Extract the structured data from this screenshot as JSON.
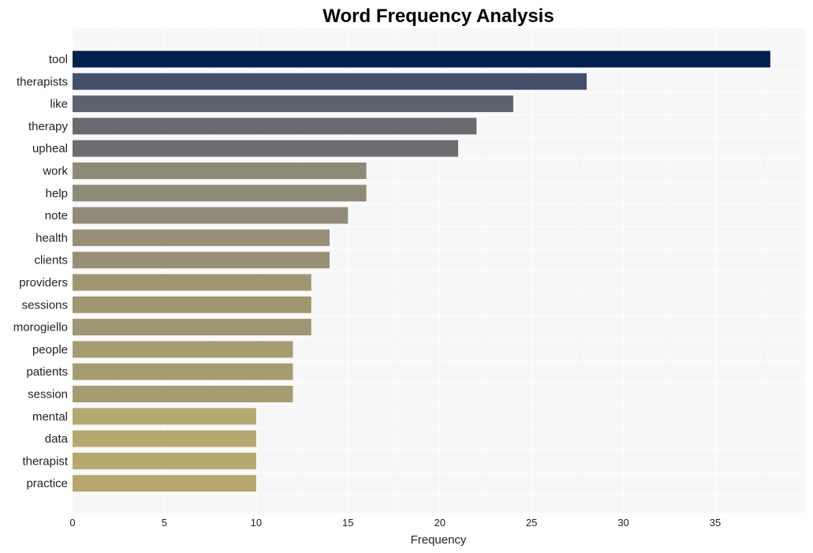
{
  "chart_data": {
    "type": "bar",
    "orientation": "horizontal",
    "title": "Word Frequency Analysis",
    "xlabel": "Frequency",
    "ylabel": "",
    "xlim": [
      0,
      40
    ],
    "xticks": [
      0,
      5,
      10,
      15,
      20,
      25,
      30,
      35
    ],
    "grid": true,
    "legend": "none",
    "categories": [
      "tool",
      "therapists",
      "like",
      "therapy",
      "upheal",
      "work",
      "help",
      "note",
      "health",
      "clients",
      "providers",
      "sessions",
      "morogiello",
      "people",
      "patients",
      "session",
      "mental",
      "data",
      "therapist",
      "practice"
    ],
    "values": [
      38,
      28,
      24,
      22,
      21,
      16,
      16,
      15,
      14,
      14,
      13,
      13,
      13,
      12,
      12,
      12,
      10,
      10,
      10,
      10
    ],
    "colors": [
      "#00204e",
      "#45516b",
      "#5c616f",
      "#696a70",
      "#6c6d71",
      "#8d8a78",
      "#8d8a78",
      "#8f8b77",
      "#979076",
      "#979076",
      "#9f9672",
      "#9f9672",
      "#9f9672",
      "#a59c72",
      "#a59c72",
      "#a59c72",
      "#b6a970",
      "#b6a970",
      "#b6a970",
      "#b6a970"
    ],
    "plot_background": "#f7f7f7"
  }
}
